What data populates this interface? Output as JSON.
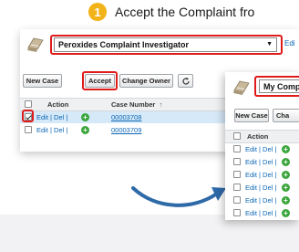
{
  "step": {
    "number": "1",
    "text": "Accept the Complaint fro"
  },
  "screen_a": {
    "view_name": "Peroxides Complaint Investigator",
    "edit_link": "Edi",
    "buttons": {
      "new_case": "New Case",
      "accept": "Accept",
      "change_owner": "Change Owner",
      "refresh_icon": "refresh-icon"
    },
    "columns": {
      "action": "Action",
      "case_number": "Case Number",
      "sort_indicator": "↑"
    },
    "rows": [
      {
        "actions": "Edit | Del |",
        "case_number": "00003708",
        "selected": true
      },
      {
        "actions": "Edit | Del |",
        "case_number": "00003709",
        "selected": false
      }
    ]
  },
  "screen_b": {
    "view_name": "My Comp",
    "buttons": {
      "new_case": "New Case",
      "change_owner_partial": "Cha"
    },
    "columns": {
      "action": "Action"
    },
    "rows": [
      {
        "actions": "Edit | Del |"
      },
      {
        "actions": "Edit | Del |"
      },
      {
        "actions": "Edit | Del |"
      },
      {
        "actions": "Edit | Del |"
      },
      {
        "actions": "Edit | Del |"
      },
      {
        "actions": "Edit | Del |"
      }
    ]
  },
  "colors": {
    "highlight": "#e01b1b",
    "badge": "#f2b318",
    "arrow": "#2e6aa8",
    "link": "#0b66b6"
  }
}
